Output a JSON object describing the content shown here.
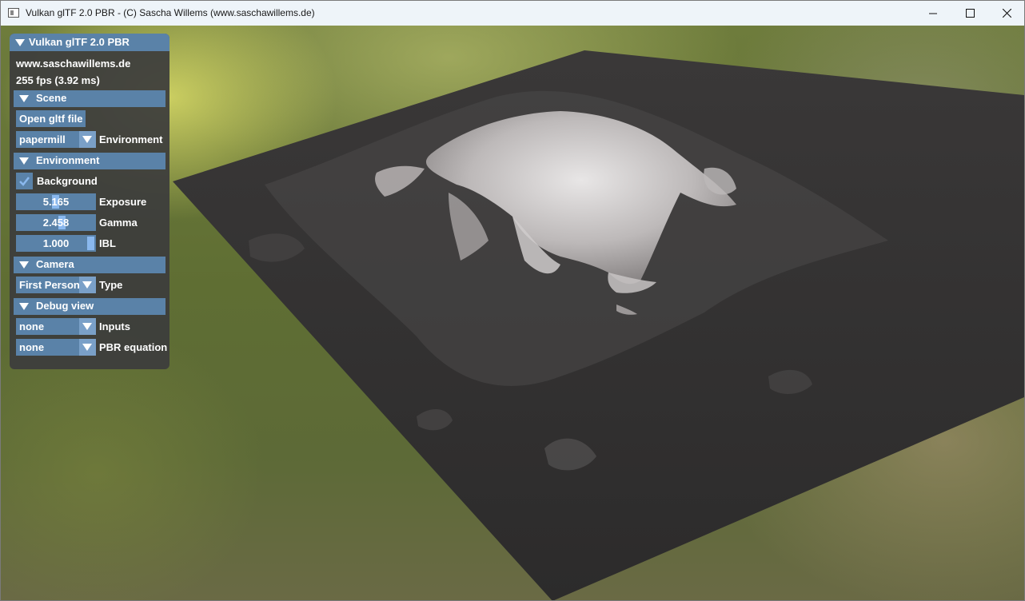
{
  "window": {
    "title": "Vulkan glTF 2.0 PBR - (C) Sascha Willems (www.saschawillems.de)"
  },
  "panel": {
    "title": "Vulkan glTF 2.0 PBR",
    "website": "www.saschawillems.de",
    "fps": "255 fps (3.92 ms)",
    "scene": {
      "header": "Scene",
      "open_button": "Open gltf file",
      "environment_value": "papermill",
      "environment_label": "Environment"
    },
    "environment": {
      "header": "Environment",
      "background_label": "Background",
      "background_checked": true,
      "exposure_value": "5.165",
      "exposure_label": "Exposure",
      "gamma_value": "2.458",
      "gamma_label": "Gamma",
      "ibl_value": "1.000",
      "ibl_label": "IBL"
    },
    "camera": {
      "header": "Camera",
      "type_value": "First Person",
      "type_label": "Type"
    },
    "debug": {
      "header": "Debug view",
      "inputs_value": "none",
      "inputs_label": "Inputs",
      "pbr_value": "none",
      "pbr_label": "PBR equation"
    }
  },
  "colors": {
    "panel_bg": "#3c3c3c",
    "accent": "#5a82a8",
    "slider_grab": "#8ab8ee"
  }
}
